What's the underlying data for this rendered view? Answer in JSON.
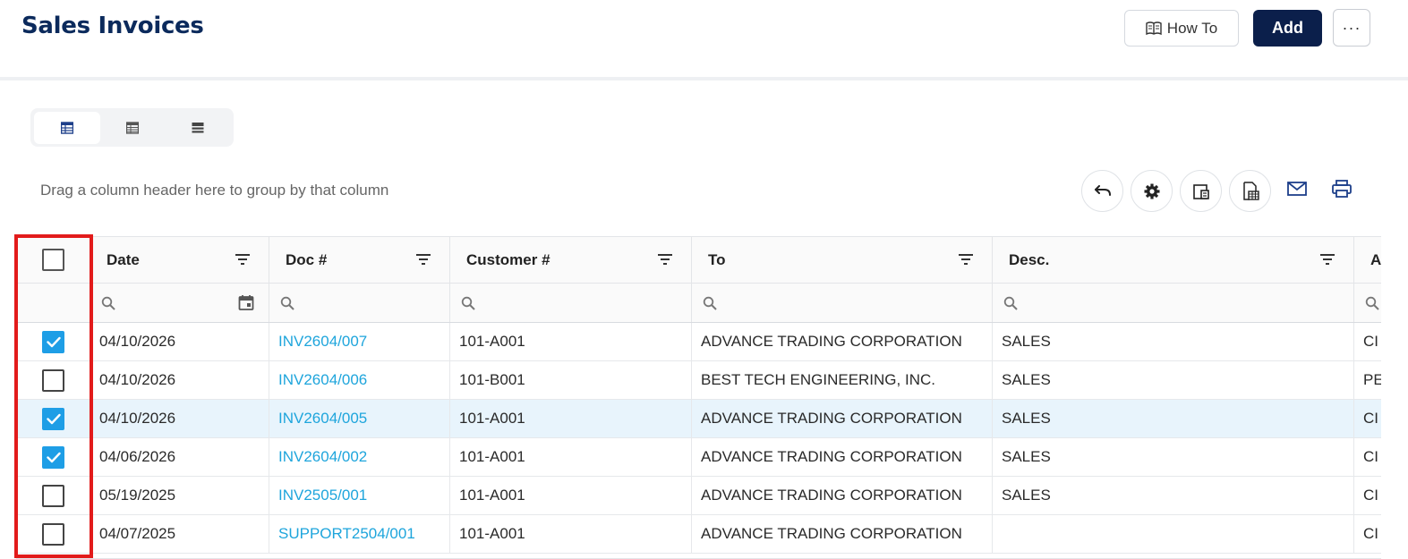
{
  "header": {
    "title": "Sales Invoices",
    "how_to_label": "How To",
    "add_label": "Add",
    "more_label": "···"
  },
  "view_toggle": {
    "options": [
      "table-view-icon",
      "compact-table-view-icon",
      "list-view-icon"
    ],
    "active_index": 0
  },
  "toolbar": {
    "group_hint": "Drag a column header here to group by that column",
    "icons": [
      "undo-icon",
      "settings-icon",
      "column-chooser-icon",
      "export-excel-icon",
      "email-icon",
      "print-icon"
    ]
  },
  "grid": {
    "columns": [
      "Date",
      "Doc #",
      "Customer #",
      "To",
      "Desc.",
      "A"
    ],
    "header_checkbox_checked": false,
    "rows": [
      {
        "checked": true,
        "date": "04/10/2026",
        "doc": "INV2604/007",
        "customer": "101-A001",
        "to": "ADVANCE TRADING CORPORATION",
        "desc": "SALES",
        "extra": "CI"
      },
      {
        "checked": false,
        "date": "04/10/2026",
        "doc": "INV2604/006",
        "customer": "101-B001",
        "to": "BEST TECH ENGINEERING, INC.",
        "desc": "SALES",
        "extra": "PE"
      },
      {
        "checked": true,
        "date": "04/10/2026",
        "doc": "INV2604/005",
        "customer": "101-A001",
        "to": "ADVANCE TRADING CORPORATION",
        "desc": "SALES",
        "extra": "CI"
      },
      {
        "checked": true,
        "date": "04/06/2026",
        "doc": "INV2604/002",
        "customer": "101-A001",
        "to": "ADVANCE TRADING CORPORATION",
        "desc": "SALES",
        "extra": "CI"
      },
      {
        "checked": false,
        "date": "05/19/2025",
        "doc": "INV2505/001",
        "customer": "101-A001",
        "to": "ADVANCE TRADING CORPORATION",
        "desc": "SALES",
        "extra": "CI"
      },
      {
        "checked": false,
        "date": "04/07/2025",
        "doc": "SUPPORT2504/001",
        "customer": "101-A001",
        "to": "ADVANCE TRADING CORPORATION",
        "desc": "",
        "extra": "CI"
      }
    ],
    "highlighted_row": 2
  },
  "colors": {
    "title": "#0b2a5c",
    "primary_button": "#0b1f4b",
    "link": "#1ea5dc",
    "checkbox_checked": "#1e9ee6",
    "row_highlight": "#e8f4fc",
    "annotation": "#e21b1b"
  }
}
